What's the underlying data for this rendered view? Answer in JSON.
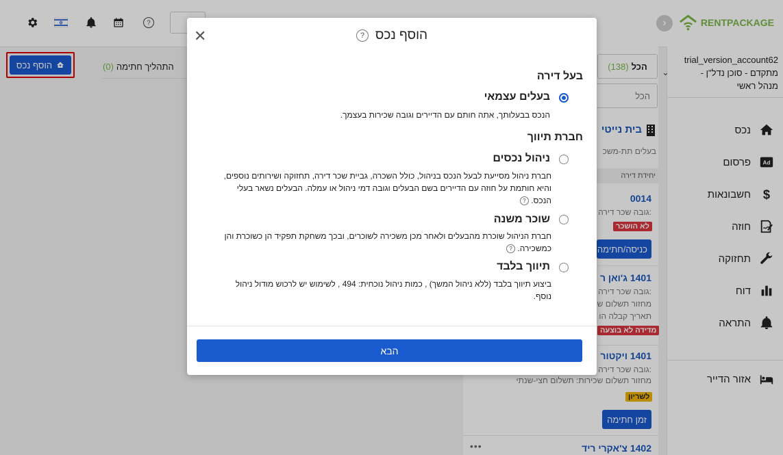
{
  "header": {
    "brand_rent": "RENT",
    "brand_package": "PACKAGE",
    "truncated_button": "ות"
  },
  "account": {
    "name": "trial_version_account62",
    "role": "מתקדם - סוכן נדל\"ן - מנהל ראשי"
  },
  "sidebar": {
    "items": [
      {
        "label": "נכס",
        "icon": "home-icon"
      },
      {
        "label": "פרסום",
        "icon": "ad-icon"
      },
      {
        "label": "חשבונאות",
        "icon": "dollar-icon"
      },
      {
        "label": "חוזה",
        "icon": "contract-icon"
      },
      {
        "label": "תחזוקה",
        "icon": "wrench-icon"
      },
      {
        "label": "דוח",
        "icon": "chart-icon"
      },
      {
        "label": "התראה",
        "icon": "bell-icon"
      }
    ],
    "tenant_area": "אזור הדייר"
  },
  "toolbar": {
    "add_property": "הוסף נכס",
    "signing_process": "התהליך חתימה",
    "signing_count": "(0)",
    "all_tab": "הכל",
    "all_count": "(138)",
    "filter_placeholder": "הכל"
  },
  "list": {
    "building_name": "בית נייטי",
    "building_sub": "בעלים תת-משכ",
    "unit_header": "יחידת דירה",
    "cards": [
      {
        "title": "0014",
        "line1": "גובה שכר דירה:",
        "tag": "לא הושכר",
        "button": "כניסה/חתימה"
      },
      {
        "title": "1401 ג'ואן ר",
        "line1": "גובה שכר דירה:",
        "line2": "מחזור תשלום ש",
        "line3": "תאריך קבלה הו",
        "tag": "מדידה לא בוצעה"
      },
      {
        "title": "1401 ויקטור",
        "line1": "גובה שכר דירה:",
        "line2": "מחזור תשלום שכירות: תשלום חצי-שנתי",
        "tag": "לשריון",
        "button": "זמן חתימה"
      },
      {
        "title": "1402 צ'אקרי ריד",
        "more": "•••"
      }
    ]
  },
  "modal": {
    "title": "הוסף נכס",
    "help": "?",
    "close": "✕",
    "section_owner": "בעל דירה",
    "section_agency": "חברת תיווך",
    "options": [
      {
        "title": "בעלים עצמאי",
        "desc": "הנכס בבעלותך, אתה חותם עם הדיירים וגובה שכירות בעצמך.",
        "selected": true
      },
      {
        "title": "ניהול נכסים",
        "desc": "חברת ניהול מסייעת לבעל הנכס בניהול, כולל השכרה, גביית שכר דירה, תחזוקה ושירותים נוספים, והיא חותמת על חוזה עם הדיירים בשם הבעלים וגובה דמי ניהול או עמלה. הבעלים נשאר בעלי הנכס.",
        "selected": false
      },
      {
        "title": "שוכר משנה",
        "desc": "חברת הניהול שוכרת מהבעלים ולאחר מכן משכירה לשוכרים, ובכך משחקת תפקיד הן כשוכרת והן כמשכירה.",
        "selected": false
      },
      {
        "title": "תיווך בלבד",
        "desc": "ביצוע תיווך בלבד (ללא ניהול המשך) , כמות ניהול נוכחית: 494 , לשימוש יש לרכוש מודול ניהול נוסף.",
        "selected": false
      }
    ],
    "next_button": "הבא"
  },
  "colors": {
    "primary": "#1a5acf",
    "brand_green": "#7ab648",
    "tag_red": "#d9363e",
    "tag_yellow": "#f0b400"
  }
}
